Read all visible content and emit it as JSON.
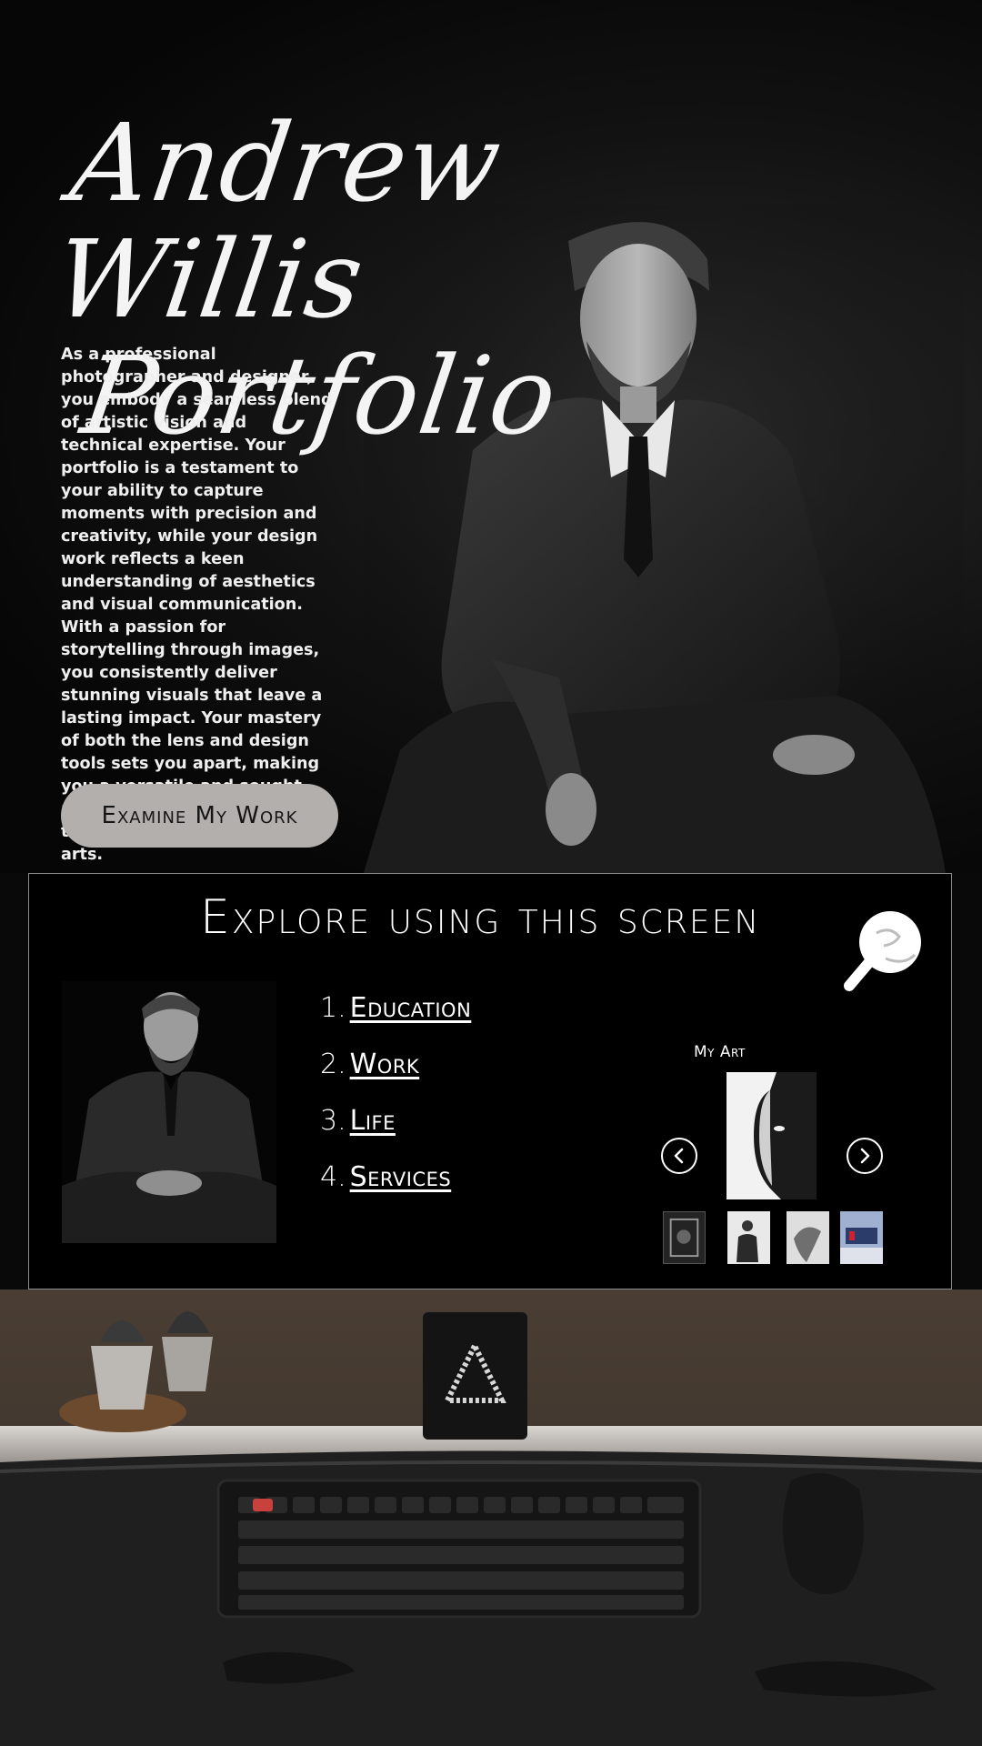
{
  "header": {
    "title_line1": "Andrew Willis",
    "title_line2": "Portfolio"
  },
  "bio": {
    "text": "As a professional photographer and designer, you embody a seamless blend of artistic vision and technical expertise. Your portfolio is a testament to your ability to capture moments with precision and creativity, while your design work reflects a keen understanding of aesthetics and visual communication. With a passion for storytelling through images, you consistently deliver stunning visuals that leave a lasting impact. Your mastery of both the lens and design tools sets you apart, making you a versatile and sought-after creative professional in the dynamic world of visual arts."
  },
  "cta": {
    "label": "Examine My Work"
  },
  "screen": {
    "title": "Explore using this screen",
    "nav": [
      {
        "num": "1.",
        "label": "Education"
      },
      {
        "num": "2.",
        "label": "Work"
      },
      {
        "num": "3.",
        "label": "Life"
      },
      {
        "num": "4.",
        "label": "Services"
      }
    ],
    "gallery": {
      "label": "My Art"
    }
  },
  "colors": {
    "background": "#090909",
    "button": "#b3afad",
    "panel": "#000000",
    "desk": "#2a2622"
  },
  "icons": [
    "pointing-hand-icon",
    "chevron-left-icon",
    "chevron-right-icon"
  ]
}
